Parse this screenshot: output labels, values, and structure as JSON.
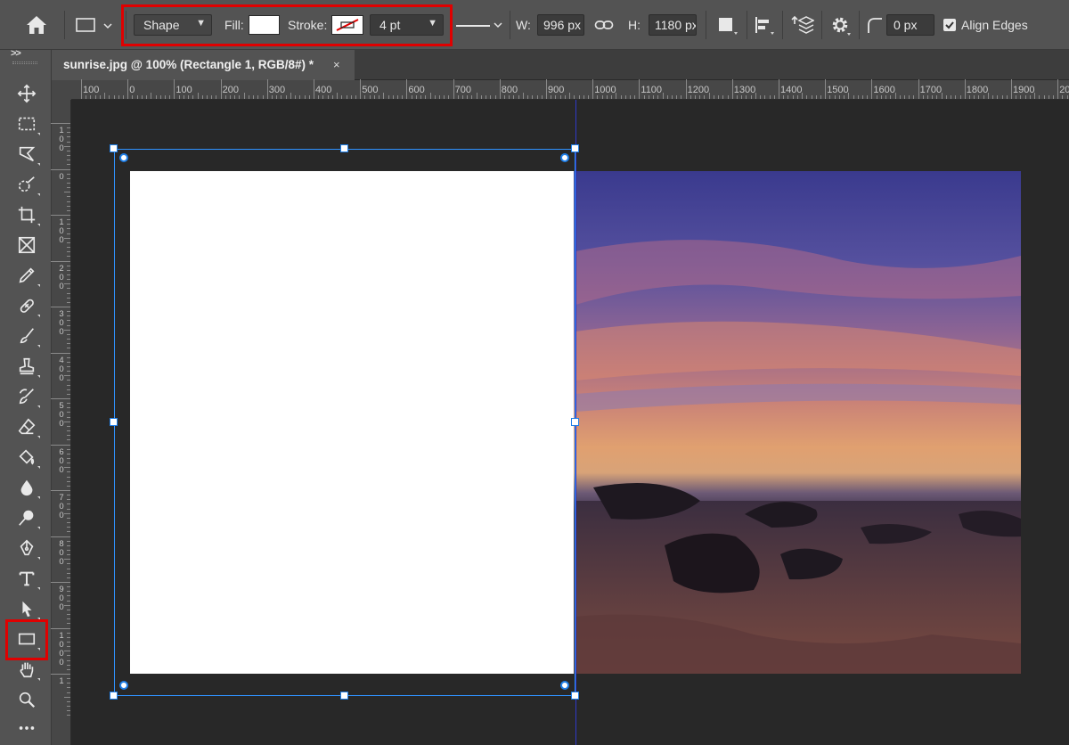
{
  "options_bar": {
    "tool_mode": "Shape",
    "fill_label": "Fill:",
    "fill_color": "#ffffff",
    "stroke_label": "Stroke:",
    "stroke_width": "4 pt",
    "width_label": "W:",
    "width_value": "996 px",
    "height_label": "H:",
    "height_value": "1180 px",
    "corner_radius": "0 px",
    "align_edges_label": "Align Edges",
    "align_edges_checked": true
  },
  "document_tab": {
    "title": "sunrise.jpg @ 100% (Rectangle 1, RGB/8#) *",
    "close_symbol": "×"
  },
  "ruler": {
    "top_labels": [
      "100",
      "0",
      "100",
      "200",
      "300",
      "400",
      "500",
      "600",
      "700",
      "800",
      "900",
      "1000",
      "1100",
      "1200",
      "1300",
      "1400",
      "1500",
      "1600",
      "1700",
      "1800",
      "1900",
      "20"
    ],
    "left_labels": [
      "100",
      "0",
      "100",
      "200",
      "300",
      "400",
      "500",
      "600",
      "700",
      "800",
      "900",
      "1000",
      "1"
    ]
  },
  "toolbar": {
    "expand_symbol": ">>",
    "tools": [
      "move-tool",
      "marquee-tool",
      "lasso-tool",
      "quick-select-tool",
      "crop-tool",
      "frame-tool",
      "eyedropper-tool",
      "healing-brush-tool",
      "brush-tool",
      "clone-stamp-tool",
      "history-brush-tool",
      "eraser-tool",
      "paint-bucket-tool",
      "blur-tool",
      "dodge-tool",
      "pen-tool",
      "type-tool",
      "path-selection-tool",
      "rectangle-tool",
      "hand-tool",
      "zoom-tool",
      "more-tools"
    ],
    "active_tool": "rectangle-tool"
  },
  "colors": {
    "accent_highlight": "#e00000",
    "selection_blue": "#2f92ff",
    "guide_blue": "#2f39c8",
    "ui_panel": "#535353",
    "canvas_bg": "#282828"
  }
}
